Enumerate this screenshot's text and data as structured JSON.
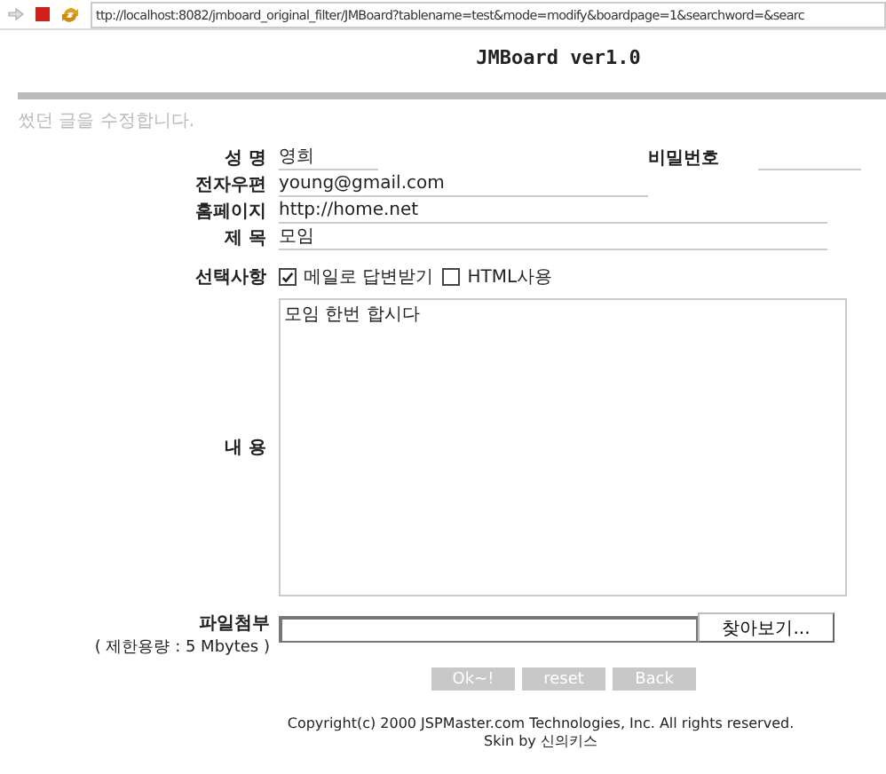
{
  "address_bar": {
    "url": "ttp://localhost:8082/jmboard_original_filter/JMBoard?tablename=test&mode=modify&boardpage=1&searchword=&searc"
  },
  "title": "JMBoard ver1.0",
  "notice": "썼던 글을 수정합니다.",
  "form": {
    "name": {
      "label": "성 명",
      "value": "영희"
    },
    "password": {
      "label": "비밀번호"
    },
    "email": {
      "label": "전자우편",
      "value": "young@gmail.com"
    },
    "homepage": {
      "label": "홈페이지",
      "value": "http://home.net"
    },
    "subject": {
      "label": "제 목",
      "value": "모임"
    },
    "options": {
      "label": "선택사항",
      "items": [
        {
          "label": "메일로 답변받기",
          "checked": true
        },
        {
          "label": "HTML사용",
          "checked": false
        }
      ]
    },
    "content": {
      "label": "내 용",
      "value": "모임 한번 합시다"
    },
    "attachment": {
      "label": "파일첨부",
      "limit": "( 제한용량 : 5 Mbytes )",
      "browse_button": "찾아보기..."
    },
    "buttons": [
      "Ok~!",
      "reset",
      "Back"
    ]
  },
  "footer": {
    "copyright": "Copyright(c) 2000 JSPMaster.com Technologies, Inc. All rights reserved.",
    "skin": "Skin by 신의키스"
  }
}
